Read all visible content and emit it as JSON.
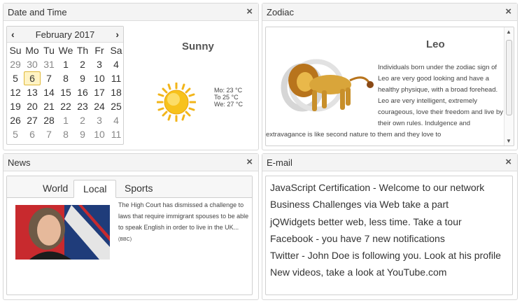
{
  "date_time_panel": {
    "title": "Date and Time",
    "close": "×",
    "calendar": {
      "prev": "‹",
      "next": "›",
      "month_year": "February 2017",
      "weekdays": [
        "Su",
        "Mo",
        "Tu",
        "We",
        "Th",
        "Fr",
        "Sa"
      ],
      "weeks": [
        [
          "29",
          "30",
          "31",
          "1",
          "2",
          "3",
          "4"
        ],
        [
          "5",
          "6",
          "7",
          "8",
          "9",
          "10",
          "11"
        ],
        [
          "12",
          "13",
          "14",
          "15",
          "16",
          "17",
          "18"
        ],
        [
          "19",
          "20",
          "21",
          "22",
          "23",
          "24",
          "25"
        ],
        [
          "26",
          "27",
          "28",
          "1",
          "2",
          "3",
          "4"
        ],
        [
          "5",
          "6",
          "7",
          "8",
          "9",
          "10",
          "11"
        ]
      ],
      "selected": "6"
    },
    "weather": {
      "condition": "Sunny",
      "icon": "sun-icon",
      "forecast": [
        "Mo: 23 °C",
        "To 25 °C",
        "We: 27 °C"
      ]
    }
  },
  "zodiac_panel": {
    "title": "Zodiac",
    "close": "×",
    "sign": "Leo",
    "icon": "leo-lion-icon",
    "text": "Individuals born under the zodiac sign of Leo are very good looking and have a healthy physique, with a broad forehead. Leo are very intelligent, extremely courageous, love their freedom and live by their own rules. Indulgence and extravagance is like second nature to them and they love to",
    "scroll_up": "▲",
    "scroll_down": "▼"
  },
  "news_panel": {
    "title": "News",
    "close": "×",
    "tabs": [
      "World",
      "Local",
      "Sports"
    ],
    "active_tab": "Local",
    "article": "The High Court has dismissed a challenge to laws that require immigrant spouses to be able to speak English in order to live in the UK...",
    "source": "(BBC)"
  },
  "email_panel": {
    "title": "E-mail",
    "close": "×",
    "items": [
      "JavaScript Certification - Welcome to our network",
      "Business Challenges via Web take a part",
      "jQWidgets better web, less time. Take a tour",
      "Facebook - you have 7 new notifications",
      "Twitter - John Doe is following you. Look at his profile",
      "New videos, take a look at YouTube.com"
    ]
  },
  "colors": {
    "header_bg": "#f4f4f4",
    "border": "#d8d8d8",
    "selected_day_bg": "#fff3c4",
    "sun_yellow": "#f7c21c"
  }
}
